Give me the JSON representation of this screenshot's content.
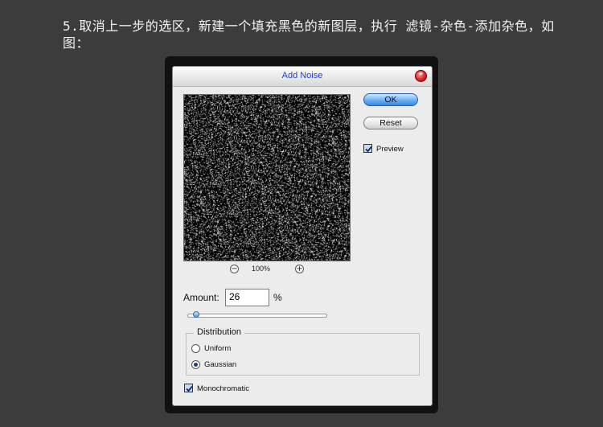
{
  "caption": "5.取消上一步的选区，新建一个填充黑色的新图层，执行 滤镜-杂色-添加杂色，如图：",
  "dialog": {
    "title": "Add Noise",
    "ok_label": "OK",
    "reset_label": "Reset",
    "preview_label": "Preview",
    "preview_checked": true,
    "zoom_level": "100%",
    "zoom_out_icon": "minus-circle-icon",
    "zoom_in_icon": "plus-circle-icon",
    "close_icon": "close-icon"
  },
  "amount": {
    "label": "Amount:",
    "value": "26",
    "unit": "%",
    "slider_value": 26
  },
  "distribution": {
    "title": "Distribution",
    "options": [
      "Uniform",
      "Gaussian"
    ],
    "selected": "Gaussian"
  },
  "monochromatic": {
    "label": "Monochromatic",
    "checked": true
  }
}
